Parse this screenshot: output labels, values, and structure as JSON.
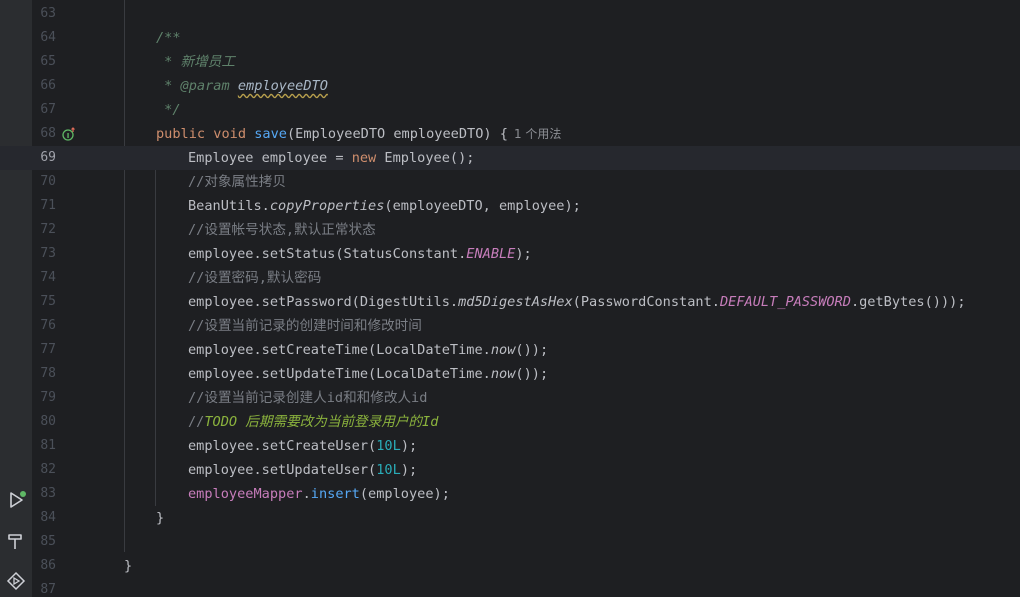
{
  "editor": {
    "lines": [
      {
        "num": "63"
      },
      {
        "num": "64",
        "comment": "/**"
      },
      {
        "num": "65",
        "comment": " * 新增员工"
      },
      {
        "num": "66",
        "param_tag": " * @param",
        "param_name": "employeeDTO"
      },
      {
        "num": "67",
        "comment": " */"
      },
      {
        "num": "68",
        "kw1": "public",
        "kw2": "void",
        "method": "save",
        "args": "(EmployeeDTO employeeDTO) {",
        "usage_hint": "1 个用法"
      },
      {
        "num": "69",
        "t1": "Employee employee = ",
        "kw": "new",
        "t2": " Employee();"
      },
      {
        "num": "70",
        "comment": "//对象属性拷贝"
      },
      {
        "num": "71",
        "t1": "BeanUtils.",
        "static_call": "copyProperties",
        "t2": "(employeeDTO, employee);"
      },
      {
        "num": "72",
        "comment": "//设置帐号状态,默认正常状态"
      },
      {
        "num": "73",
        "t1": "employee.setStatus(StatusConstant.",
        "const": "ENABLE",
        "t2": ");"
      },
      {
        "num": "74",
        "comment": "//设置密码,默认密码"
      },
      {
        "num": "75",
        "t1": "employee.setPassword(DigestUtils.",
        "static_call": "md5DigestAsHex",
        "t2": "(PasswordConstant.",
        "const": "DEFAULT_PASSWORD",
        "t3": ".getBytes()));"
      },
      {
        "num": "76",
        "comment": "//设置当前记录的创建时间和修改时间"
      },
      {
        "num": "77",
        "t1": "employee.setCreateTime(LocalDateTime.",
        "static_call": "now",
        "t2": "());"
      },
      {
        "num": "78",
        "t1": "employee.setUpdateTime(LocalDateTime.",
        "static_call": "now",
        "t2": "());"
      },
      {
        "num": "79",
        "comment": "//设置当前记录创建人id和和修改人id"
      },
      {
        "num": "80",
        "todo_prefix": "//",
        "todo_text": "TODO 后期需要改为当前登录用户的Id"
      },
      {
        "num": "81",
        "t1": "employee.setCreateUser(",
        "number": "10L",
        "t2": ");"
      },
      {
        "num": "82",
        "t1": "employee.setUpdateUser(",
        "number": "10L",
        "t2": ");"
      },
      {
        "num": "83",
        "field": "employeeMapper",
        "dot": ".",
        "method": "insert",
        "t2": "(employee);"
      },
      {
        "num": "84",
        "brace": "}"
      },
      {
        "num": "85"
      },
      {
        "num": "86",
        "brace": "}"
      },
      {
        "num": "87"
      }
    ]
  },
  "colors": {
    "background": "#1e1f22",
    "keyword": "#cf8e6d",
    "method": "#56a8f5",
    "constant": "#c77dbb",
    "number": "#2aacb8",
    "todo": "#8bb33d"
  },
  "icons": {
    "gutter_line_68": "implements-method-icon",
    "sidebar": [
      "run-icon",
      "build-hammer-icon",
      "services-icon"
    ]
  }
}
